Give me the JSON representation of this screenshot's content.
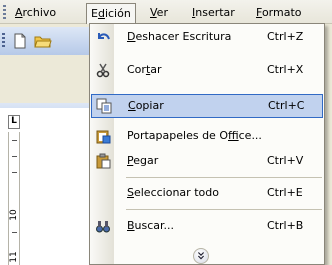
{
  "menubar": {
    "items": [
      {
        "label": "Archivo"
      },
      {
        "label": "Edición"
      },
      {
        "label": "Ver"
      },
      {
        "label": "Insertar"
      },
      {
        "label": "Formato"
      }
    ]
  },
  "edit_menu": {
    "items": [
      {
        "label": "Deshacer Escritura",
        "shortcut": "Ctrl+Z",
        "icon": "undo-icon"
      },
      {
        "label": "Cortar",
        "shortcut": "Ctrl+X",
        "icon": "scissors-icon"
      },
      {
        "label": "Copiar",
        "shortcut": "Ctrl+C",
        "icon": "copy-icon",
        "highlighted": true
      },
      {
        "label": "Portapapeles de Office...",
        "shortcut": "",
        "icon": "office-clipboard-icon"
      },
      {
        "label": "Pegar",
        "shortcut": "Ctrl+V",
        "icon": "paste-icon"
      },
      {
        "label": "Seleccionar todo",
        "shortcut": "Ctrl+E",
        "icon": ""
      },
      {
        "label": "Buscar...",
        "shortcut": "Ctrl+B",
        "icon": "binoculars-icon"
      }
    ],
    "expand_icon": "chevron-double-down-icon"
  },
  "ruler": {
    "tab_marker": "L",
    "numbers": [
      "10",
      "11"
    ]
  },
  "colors": {
    "highlight_bg": "#c1d2ee",
    "highlight_border": "#316ac5",
    "toolbar_blue": "#b6c9e8"
  }
}
